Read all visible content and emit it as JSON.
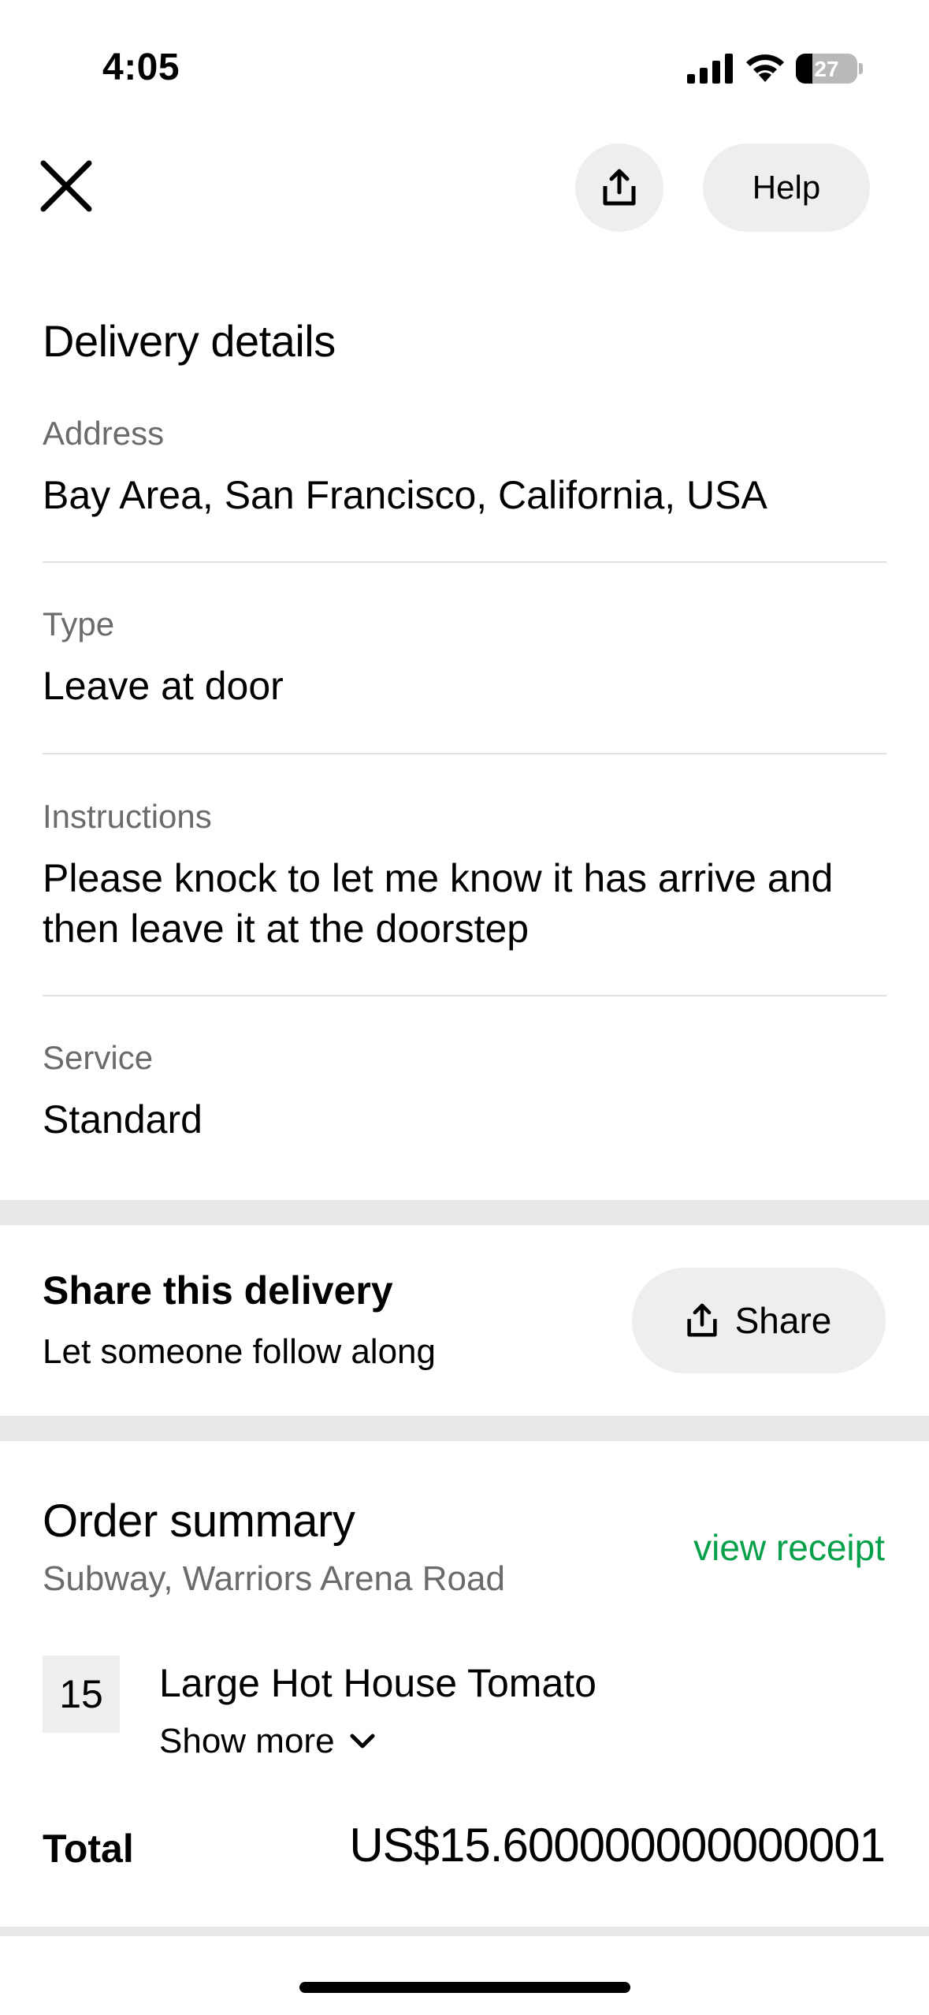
{
  "status_bar": {
    "time": "4:05",
    "battery": "27",
    "battery_level": 0.27,
    "icons": [
      "cellular-signal-icon",
      "wifi-icon",
      "battery-icon"
    ]
  },
  "top_bar": {
    "close_icon": "close-icon",
    "share_icon": "share-icon",
    "help_label": "Help"
  },
  "delivery_details": {
    "title": "Delivery details",
    "fields": [
      {
        "label": "Address",
        "value": "Bay Area, San Francisco, California, USA"
      },
      {
        "label": "Type",
        "value": "Leave at door"
      },
      {
        "label": "Instructions",
        "value": "Please knock to let me know it has arrive and then leave it at the doorstep"
      },
      {
        "label": "Service",
        "value": "Standard"
      }
    ]
  },
  "share": {
    "title": "Share this delivery",
    "subtitle": "Let someone follow along",
    "button_label": "Share"
  },
  "order_summary": {
    "title": "Order summary",
    "store": "Subway, Warriors Arena Road",
    "receipt_link": "view receipt",
    "items": [
      {
        "quantity": "15",
        "name": "Large Hot House Tomato",
        "show_more": "Show more"
      }
    ],
    "total_label": "Total",
    "total_value": "US$15.600000000000001"
  },
  "colors": {
    "accent_green": "#06a04a",
    "secondary_text": "#6b6b6b",
    "button_bg": "#eeeeee",
    "section_band": "#e8e8e8"
  }
}
